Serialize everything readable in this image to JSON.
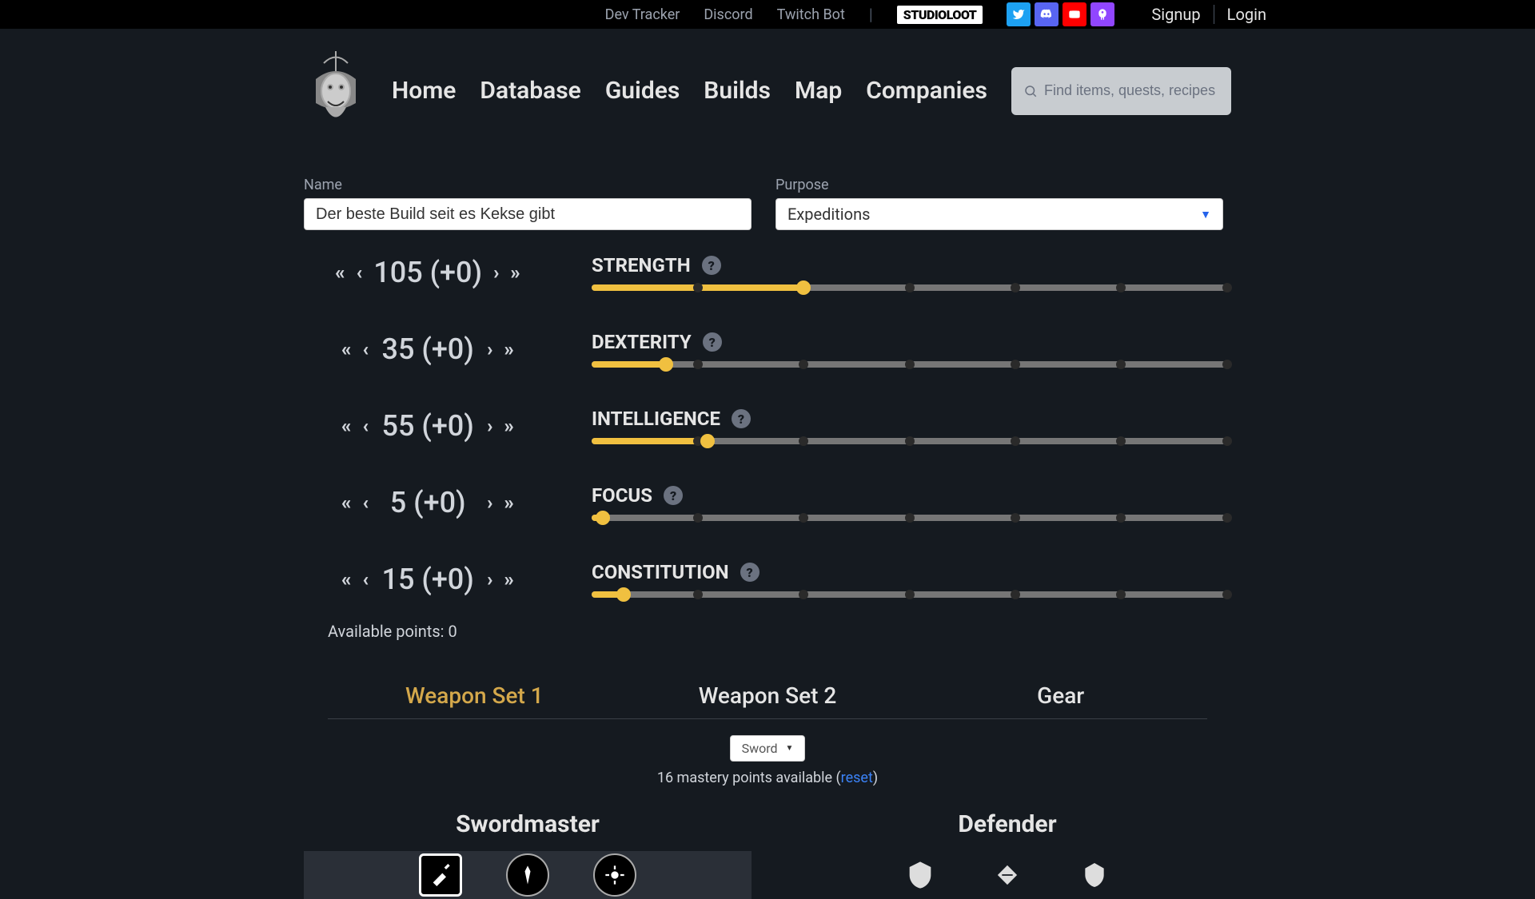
{
  "topbar": {
    "links": [
      "Dev Tracker",
      "Discord",
      "Twitch Bot"
    ],
    "brand": "STUDIOLOOT",
    "signup": "Signup",
    "login": "Login"
  },
  "nav": {
    "items": [
      "Home",
      "Database",
      "Guides",
      "Builds",
      "Map",
      "Companies"
    ],
    "search_placeholder": "Find items, quests, recipes and guides..."
  },
  "form": {
    "name_label": "Name",
    "name_value": "Der beste Build seit es Kekse gibt",
    "purpose_label": "Purpose",
    "purpose_value": "Expeditions"
  },
  "attrs": [
    {
      "name": "STRENGTH",
      "value": 105,
      "bonus": 0,
      "fill_pct": 33.3
    },
    {
      "name": "DEXTERITY",
      "value": 35,
      "bonus": 0,
      "fill_pct": 11.7
    },
    {
      "name": "INTELLIGENCE",
      "value": 55,
      "bonus": 0,
      "fill_pct": 18.3
    },
    {
      "name": "FOCUS",
      "value": 5,
      "bonus": 0,
      "fill_pct": 1.7
    },
    {
      "name": "CONSTITUTION",
      "value": 15,
      "bonus": 0,
      "fill_pct": 5
    }
  ],
  "tick_positions": [
    16.67,
    33.33,
    50,
    66.67,
    83.33,
    100
  ],
  "available_label": "Available points:",
  "available_value": 0,
  "tabs": [
    "Weapon Set 1",
    "Weapon Set 2",
    "Gear"
  ],
  "weapon": {
    "selected": "Sword",
    "mastery_prefix": "16 mastery points available (",
    "reset": "reset",
    "mastery_suffix": ")"
  },
  "trees": {
    "left": "Swordmaster",
    "right": "Defender"
  }
}
